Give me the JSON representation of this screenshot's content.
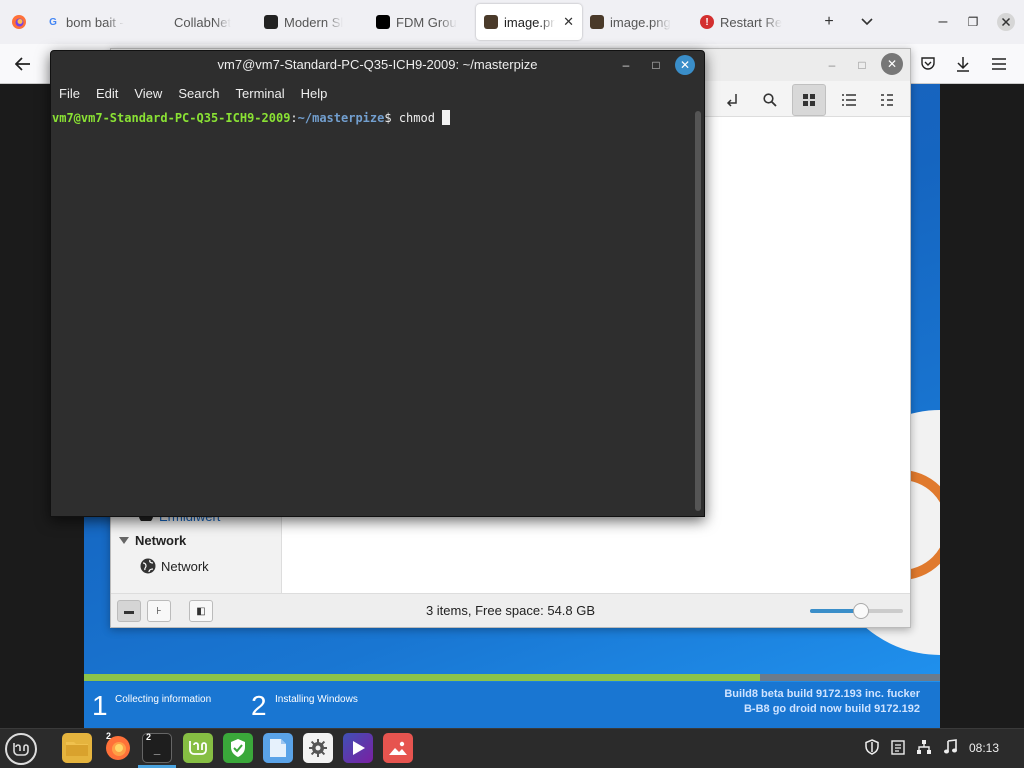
{
  "browser": {
    "tabs": [
      {
        "title": "bom bait -",
        "favicon": "G",
        "favicon_color": "#4285f4",
        "active": false
      },
      {
        "title": "CollabNet",
        "favicon": "",
        "favicon_color": "#f0f0f4",
        "active": false
      },
      {
        "title": "Modern Sl",
        "favicon": "",
        "favicon_color": "#222222",
        "active": false
      },
      {
        "title": "FDM Grou",
        "favicon": "",
        "favicon_color": "#000000",
        "active": false
      },
      {
        "title": "image.pn",
        "favicon": "",
        "favicon_color": "#4a3a2a",
        "active": true
      },
      {
        "title": "image.png",
        "favicon": "",
        "favicon_color": "#4a3a2a",
        "active": false
      },
      {
        "title": "Restart Re",
        "favicon": "!",
        "favicon_color": "#d32f2f",
        "active": false
      }
    ]
  },
  "terminal": {
    "title": "vm7@vm7-Standard-PC-Q35-ICH9-2009: ~/masterpize",
    "menu": [
      "File",
      "Edit",
      "View",
      "Search",
      "Terminal",
      "Help"
    ],
    "prompt_user": "vm7@vm7-Standard-PC-Q35-ICH9-2009",
    "prompt_sep": ":",
    "prompt_path": "~/masterpize",
    "prompt_symbol": "$ ",
    "command": "chmod "
  },
  "file_manager": {
    "sidebar": {
      "partial_item": "Ermidiwert",
      "section": "Network",
      "item": "Network"
    },
    "status": "3 items, Free space: 54.8 GB",
    "zoom_level": 0.55
  },
  "installer": {
    "progress": 0.79,
    "step1_number": "1",
    "step1_label": "Collecting information",
    "step2_number": "2",
    "step2_label": "Installing Windows",
    "build_line1": "Build8 beta build 9172.193 inc. fucker",
    "build_line2": "B-B8 go droid now build 9172.192"
  },
  "taskbar": {
    "clock": "08:13",
    "badges": {
      "firefox": "2",
      "terminal": "2"
    }
  }
}
